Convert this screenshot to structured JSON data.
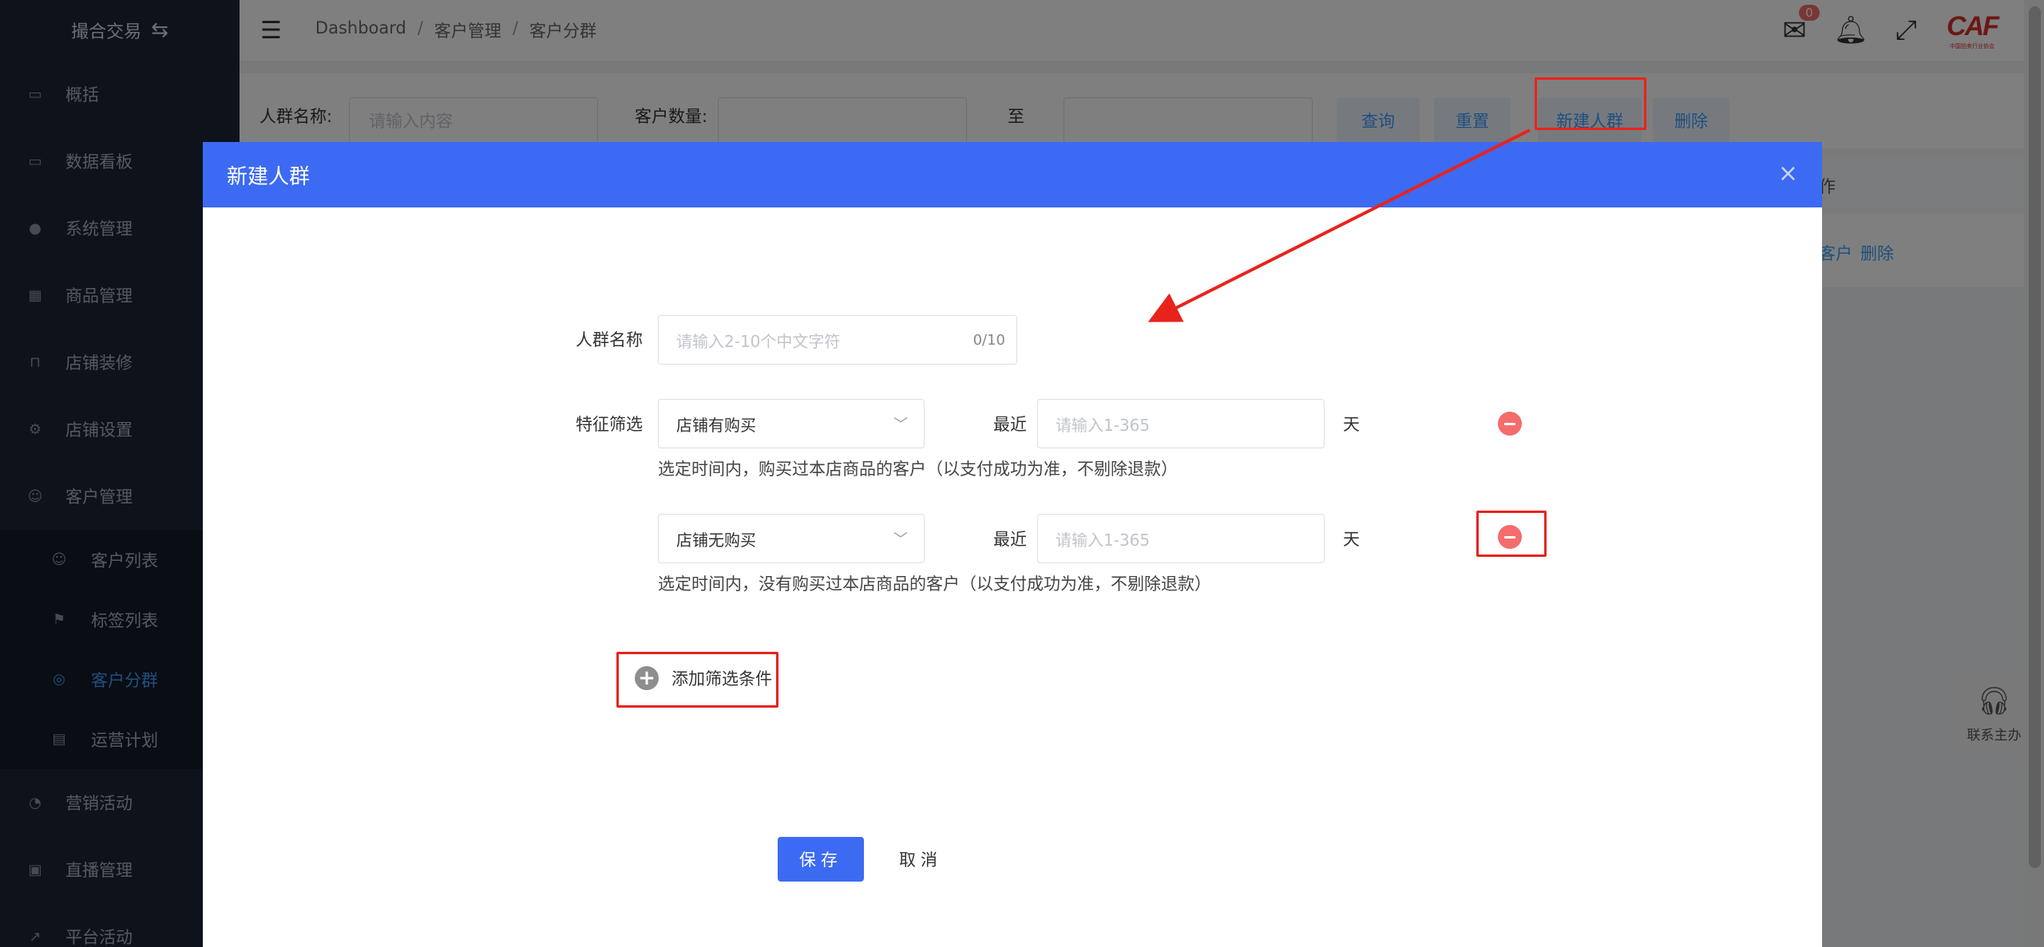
{
  "sidebar": {
    "brand": "撮合交易",
    "items": [
      {
        "label": "概括",
        "icon": "monitor-icon"
      },
      {
        "label": "数据看板",
        "icon": "monitor-icon"
      },
      {
        "label": "系统管理",
        "icon": "settings-icon"
      },
      {
        "label": "商品管理",
        "icon": "grid-icon"
      },
      {
        "label": "店铺装修",
        "icon": "easel-icon"
      },
      {
        "label": "店铺设置",
        "icon": "gear-icon"
      },
      {
        "label": "客户管理",
        "icon": "user-icon"
      }
    ],
    "submenu": [
      {
        "label": "客户列表",
        "icon": "user-icon"
      },
      {
        "label": "标签列表",
        "icon": "bookmark-icon"
      },
      {
        "label": "客户分群",
        "icon": "group-icon",
        "active": true
      },
      {
        "label": "运营计划",
        "icon": "card-icon"
      }
    ],
    "items_after": [
      {
        "label": "营销活动",
        "icon": "compass-icon"
      },
      {
        "label": "直播管理",
        "icon": "video-icon"
      },
      {
        "label": "平台活动",
        "icon": "chart-icon"
      }
    ]
  },
  "header": {
    "breadcrumb": [
      "Dashboard",
      "客户管理",
      "客户分群"
    ],
    "breadcrumb_sep": "/",
    "mail_badge": "0",
    "logo_text": "CAF",
    "logo_sub": "中国拍卖行业协会"
  },
  "filter": {
    "name_label": "人群名称:",
    "name_placeholder": "请输入内容",
    "count_label": "客户数量:",
    "to_label": "至",
    "query": "查询",
    "reset": "重置",
    "create": "新建人群",
    "delete": "删除"
  },
  "table": {
    "op_header_partial": "作",
    "row_ops": [
      "客户",
      "删除"
    ]
  },
  "contact": {
    "label": "联系主办"
  },
  "dialog": {
    "title": "新建人群",
    "close": "×",
    "name_label": "人群名称",
    "name_placeholder": "请输入2-10个中文字符",
    "name_counter": "0/10",
    "feature_label": "特征筛选",
    "conditions": [
      {
        "select": "店铺有购买",
        "recent_label": "最近",
        "days_placeholder": "请输入1-365",
        "unit": "天",
        "hint": "选定时间内，购买过本店商品的客户（以支付成功为准，不剔除退款）"
      },
      {
        "select": "店铺无购买",
        "recent_label": "最近",
        "days_placeholder": "请输入1-365",
        "unit": "天",
        "hint": "选定时间内，没有购买过本店商品的客户（以支付成功为准，不剔除退款）"
      }
    ],
    "add_condition": "添加筛选条件",
    "save": "保存",
    "cancel": "取消"
  },
  "colors": {
    "sidebar_bg": "#1c2637",
    "primary": "#3c6af2",
    "danger": "#f56c6c",
    "highlight": "#e8231c"
  }
}
